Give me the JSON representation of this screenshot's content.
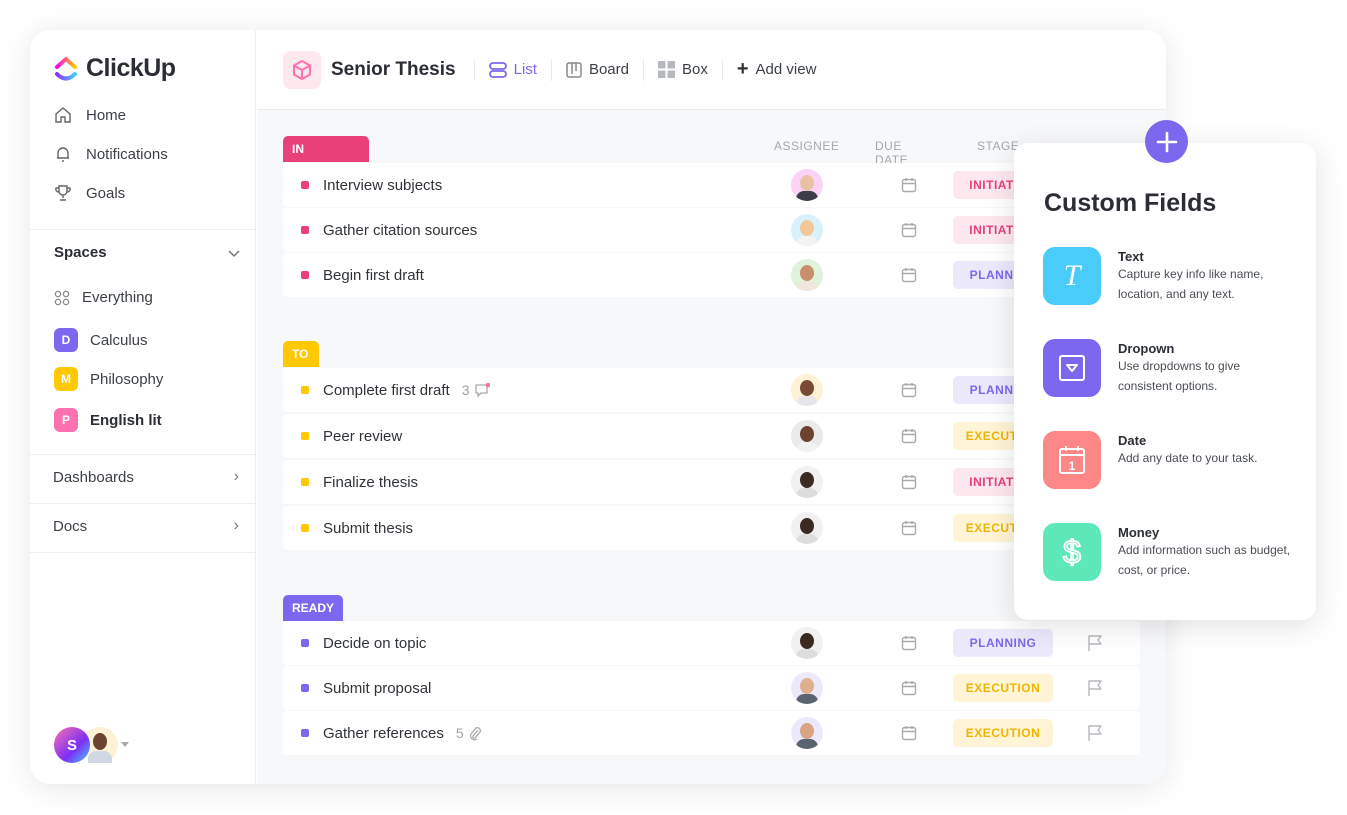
{
  "brand": {
    "name": "ClickUp"
  },
  "sidebar": {
    "nav": [
      {
        "label": "Home",
        "icon": "home-icon"
      },
      {
        "label": "Notifications",
        "icon": "bell-icon"
      },
      {
        "label": "Goals",
        "icon": "trophy-icon"
      }
    ],
    "spaces_label": "Spaces",
    "everything": "Everything",
    "spaces": [
      {
        "initial": "D",
        "label": "Calculus",
        "color": "#7b68ee"
      },
      {
        "initial": "M",
        "label": "Philosophy",
        "color": "#ffc800"
      },
      {
        "initial": "P",
        "label": "English lit",
        "color": "#fd71af"
      }
    ],
    "dashboards": "Dashboards",
    "docs": "Docs",
    "user_initial": "S"
  },
  "header": {
    "title": "Senior Thesis",
    "views": [
      {
        "label": "List",
        "active": true
      },
      {
        "label": "Board"
      },
      {
        "label": "Box"
      }
    ],
    "add_view": "Add view"
  },
  "columns": {
    "assignee": "ASSIGNEE",
    "due_date": "DUE DATE",
    "stage": "STAGE"
  },
  "groups": [
    {
      "label": "IN PROGRESS",
      "color": "#e9407a",
      "tasks": [
        {
          "name": "Interview subjects",
          "stage": "INITIATION"
        },
        {
          "name": "Gather citation sources",
          "stage": "INITIATION"
        },
        {
          "name": "Begin first draft",
          "stage": "PLANNING"
        }
      ]
    },
    {
      "label": "TO DO",
      "color": "#ffc800",
      "tasks": [
        {
          "name": "Complete first draft",
          "meta": "3",
          "meta_icon": "comment-icon",
          "stage": "PLANNING"
        },
        {
          "name": "Peer review",
          "stage": "EXECUTION"
        },
        {
          "name": "Finalize thesis",
          "stage": "INITIATION"
        },
        {
          "name": "Submit thesis",
          "stage": "EXECUTION"
        }
      ]
    },
    {
      "label": "READY",
      "color": "#7b68ee",
      "tasks": [
        {
          "name": "Decide on topic",
          "stage": "PLANNING"
        },
        {
          "name": "Submit proposal",
          "stage": "EXECUTION"
        },
        {
          "name": "Gather references",
          "meta": "5",
          "meta_icon": "paperclip-icon",
          "stage": "EXECUTION"
        }
      ]
    }
  ],
  "custom_fields": {
    "title": "Custom Fields",
    "items": [
      {
        "name": "Text",
        "desc": "Capture key info like name, location, and any text.",
        "color": "#49ccf9",
        "icon": "text-icon"
      },
      {
        "name": "Dropown",
        "desc": "Use dropdowns to give consistent options.",
        "color": "#7b68ee",
        "icon": "dropdown-icon"
      },
      {
        "name": "Date",
        "desc": "Add any date to your task.",
        "color": "#fd8787",
        "icon": "calendar-icon"
      },
      {
        "name": "Money",
        "desc": "Add information such as budget, cost, or price.",
        "color": "#5ee8b8",
        "icon": "dollar-icon"
      }
    ]
  }
}
